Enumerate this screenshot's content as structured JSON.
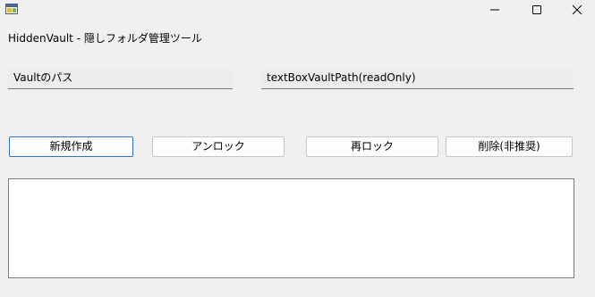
{
  "window": {
    "app_icon": "app-icon",
    "controls": {
      "minimize_icon": "minimize-icon",
      "maximize_icon": "maximize-icon",
      "close_icon": "close-icon"
    }
  },
  "form": {
    "title_label": "HiddenVault - 隠しフォルダ管理ツール",
    "vault_path_label": "Vaultのパス",
    "vault_path_value": "textBoxVaultPath(readOnly)"
  },
  "buttons": {
    "new": "新規作成",
    "unlock": "アンロック",
    "relock": "再ロック",
    "delete": "削除(非推奨)"
  },
  "colors": {
    "background": "#f0f0f0",
    "focus_border": "#2f72c6"
  }
}
